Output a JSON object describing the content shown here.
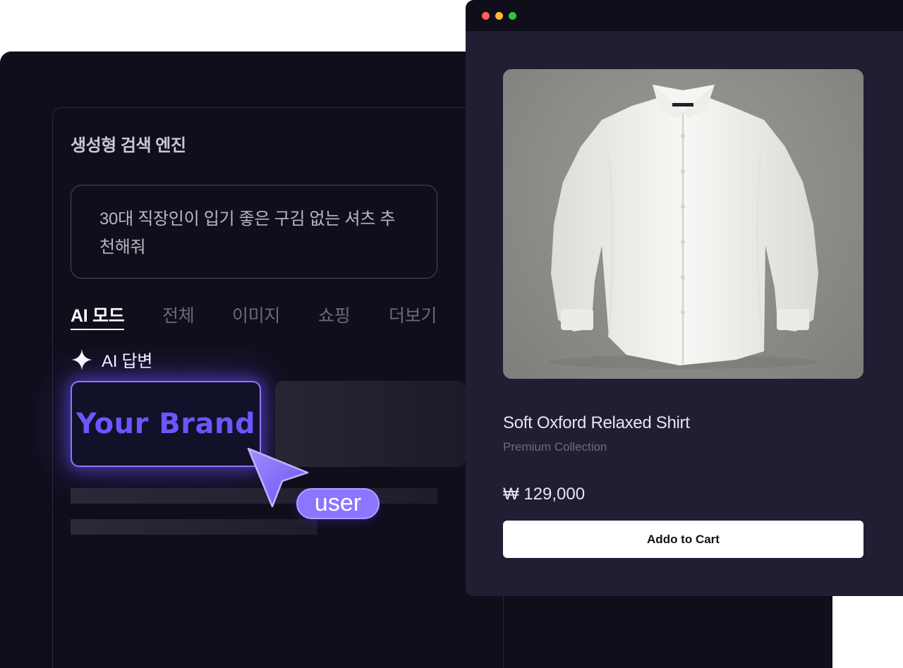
{
  "search_panel": {
    "title": "생성형 검색 엔진",
    "query": "30대 직장인이 입기 좋은 구김 없는 셔츠 추천해줘",
    "tabs": [
      {
        "label": "AI 모드",
        "active": true
      },
      {
        "label": "전체",
        "active": false
      },
      {
        "label": "이미지",
        "active": false
      },
      {
        "label": "쇼핑",
        "active": false
      },
      {
        "label": "더보기",
        "active": false
      }
    ],
    "ai_answer_label": "AI 답변",
    "ai_answer_icon": "sparkle-icon",
    "brand_card_text": "Your Brand",
    "brand_color": "#6a57ff"
  },
  "cursor": {
    "icon": "pointer-cursor-icon",
    "user_tag": "user",
    "color": "#8e75ff"
  },
  "product_window": {
    "traffic_lights": [
      "#ff5f57",
      "#febc2e",
      "#28c840"
    ],
    "image_subject": "white-shirt",
    "product_name": "Soft Oxford Relaxed Shirt",
    "collection": "Premium Collection",
    "price": "₩ 129,000",
    "button_label": "Addo to Cart"
  }
}
